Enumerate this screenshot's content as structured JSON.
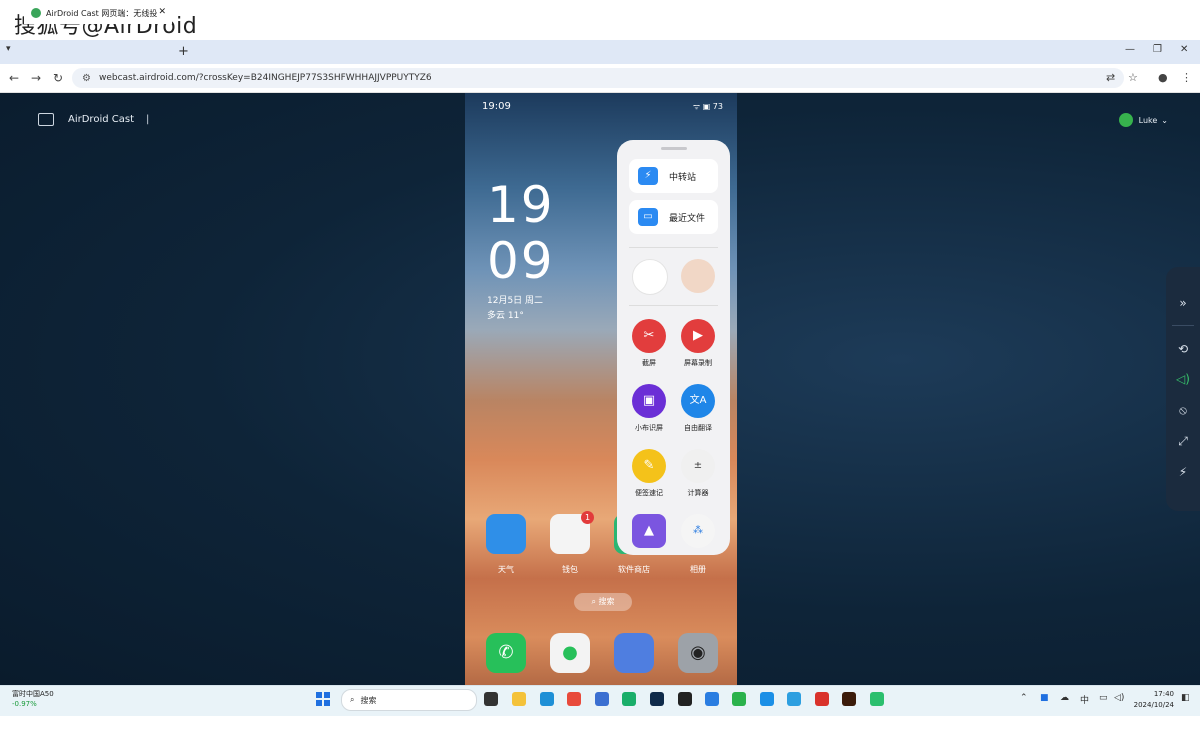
{
  "watermark": "搜狐号@AirDroid",
  "browser": {
    "tab_title": "AirDroid Cast 网页端：无线投",
    "new_tab": "+",
    "url": "webcast.airdroid.com/?crossKey=B24INGHEJP77S3SHFWHHAJJVPPUYTYZ6"
  },
  "page": {
    "brand": "AirDroid Cast",
    "brand_sep": "|",
    "user_name": "Luke"
  },
  "phone": {
    "time": "19:09",
    "status_right": "ᯤ ▣ 73",
    "clock_hour": "19",
    "clock_min": "09",
    "date": "12月5日  周二",
    "weather": "多云  11°",
    "apps": [
      {
        "label": "天气",
        "color": "#2f8fe8"
      },
      {
        "label": "钱包",
        "color": "#f4f4f4"
      },
      {
        "label": "软件商店",
        "color": "#2bb673"
      },
      {
        "label": "相册",
        "color": "#ffffff"
      }
    ],
    "wallet_badge": "1",
    "search_label": "搜索",
    "dock": [
      {
        "name": "phone",
        "color": "#27c05a"
      },
      {
        "name": "messages",
        "color": "#f3f3f3"
      },
      {
        "name": "browser",
        "color": "#4f7ee0"
      },
      {
        "name": "camera",
        "color": "#9da2a8"
      }
    ]
  },
  "panel": {
    "card1": "中转站",
    "card2": "最近文件",
    "tools": [
      {
        "label": "截屏",
        "color": "#e23d3d"
      },
      {
        "label": "屏幕录制",
        "color": "#e23d3d"
      },
      {
        "label": "小布识屏",
        "color": "#6b2fd6"
      },
      {
        "label": "自由翻译",
        "color": "#1f86e8"
      },
      {
        "label": "便签速记",
        "color": "#f4c21a"
      },
      {
        "label": "计算器",
        "color": "#f0f0f0"
      }
    ]
  },
  "taskbar": {
    "stock_name": "富时中国A50",
    "stock_change": "-0.97%",
    "search_placeholder": "搜索",
    "ime": "中",
    "time": "17:40",
    "date": "2024/10/24"
  }
}
